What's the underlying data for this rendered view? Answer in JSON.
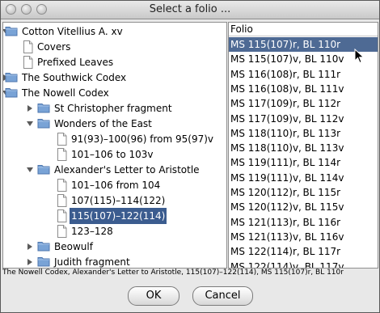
{
  "window": {
    "title": "Select a folio ..."
  },
  "tree": {
    "rows": [
      {
        "label": "Cotton Vitellius A. xv",
        "icon": "folder-icon",
        "expander": "chevron-down-icon"
      },
      {
        "label": "Covers",
        "icon": "document-icon"
      },
      {
        "label": "Prefixed Leaves",
        "icon": "document-icon"
      },
      {
        "label": "The Southwick Codex",
        "icon": "folder-icon",
        "expander": "chevron-right-icon"
      },
      {
        "label": "The Nowell Codex",
        "icon": "folder-icon",
        "expander": "chevron-down-icon"
      },
      {
        "label": "St Christopher fragment",
        "icon": "folder-icon",
        "expander": "chevron-right-icon"
      },
      {
        "label": "Wonders of the East",
        "icon": "folder-icon",
        "expander": "chevron-down-icon"
      },
      {
        "label": "91(93)–100(96) from 95(97)v",
        "icon": "document-icon"
      },
      {
        "label": "101–106 to 103v",
        "icon": "document-icon"
      },
      {
        "label": "Alexander's Letter to Aristotle",
        "icon": "folder-icon",
        "expander": "chevron-down-icon"
      },
      {
        "label": "101–106 from 104",
        "icon": "document-icon"
      },
      {
        "label": "107(115)–114(122)",
        "icon": "document-icon"
      },
      {
        "label": "115(107)–122(114)",
        "icon": "document-icon",
        "selected": true
      },
      {
        "label": "123–128",
        "icon": "document-icon"
      },
      {
        "label": "Beowulf",
        "icon": "folder-icon",
        "expander": "chevron-right-icon"
      },
      {
        "label": "Judith fragment",
        "icon": "folder-icon",
        "expander": "chevron-right-icon"
      }
    ]
  },
  "folio_list": {
    "header": "Folio",
    "items": [
      "MS 115(107)r, BL 110r",
      "MS 115(107)v, BL 110v",
      "MS 116(108)r, BL 111r",
      "MS 116(108)v, BL 111v",
      "MS 117(109)r, BL 112r",
      "MS 117(109)v, BL 112v",
      "MS 118(110)r, BL 113r",
      "MS 118(110)v, BL 113v",
      "MS 119(111)r, BL 114r",
      "MS 119(111)v, BL 114v",
      "MS 120(112)r, BL 115r",
      "MS 120(112)v, BL 115v",
      "MS 121(113)r, BL 116r",
      "MS 121(113)v, BL 116v",
      "MS 122(114)r, BL 117r",
      "MS 122(114)v, BL 117v"
    ],
    "selected_index": 0
  },
  "status": {
    "text": "The Nowell Codex, Alexander's Letter to Aristotle, 115(107)–122(114), MS 115(107)r, BL 110r"
  },
  "buttons": {
    "ok": "OK",
    "cancel": "Cancel"
  },
  "colors": {
    "selection": "#3b5c8f",
    "folder": "#6f9ad0"
  }
}
